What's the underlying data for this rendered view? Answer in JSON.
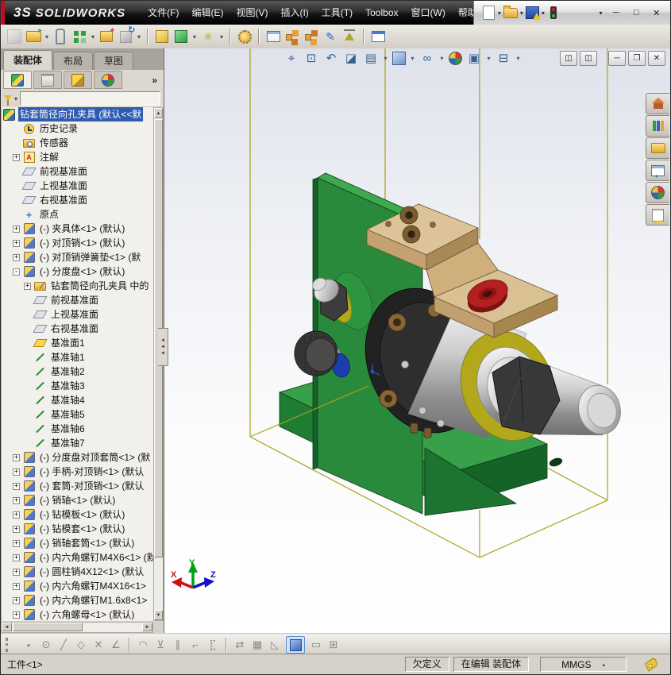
{
  "colors": {
    "brand_red": "#c20d1e",
    "selection_blue": "#2f5bb0",
    "base_green": "#2f8f3f",
    "bracket_tan": "#d9c194",
    "ring_yellow": "#b3a81c",
    "bushing_red": "#b42020",
    "collar_blue": "#1c3dae",
    "bbox_yellow": "#a9a114"
  },
  "titlebar": {
    "logo_prefix": "3S",
    "logo_text": "SOLIDWORKS",
    "menus": [
      {
        "label": "文件(F)"
      },
      {
        "label": "编辑(E)"
      },
      {
        "label": "视图(V)"
      },
      {
        "label": "插入(I)"
      },
      {
        "label": "工具(T)"
      },
      {
        "label": "Toolbox"
      },
      {
        "label": "窗口(W)"
      },
      {
        "label": "帮助(H)"
      }
    ],
    "window_buttons": {
      "minimize": "─",
      "maximize": "□",
      "close": "✕"
    }
  },
  "quick_access": {
    "buttons": [
      {
        "name": "new-document-button",
        "shape": "page",
        "dd": "▾"
      },
      {
        "name": "open-document-button",
        "shape": "folder",
        "dd": "▾"
      },
      {
        "name": "save-document-button",
        "shape": "save-warn",
        "dd": "▾"
      },
      {
        "name": "solidworks-resources-icon",
        "shape": "traffic-light",
        "dd": ""
      },
      {
        "name": "info-icon",
        "shape": "info",
        "dd": ""
      },
      {
        "name": "help-button",
        "shape": "help",
        "dd": "▾"
      }
    ]
  },
  "assembly_toolbar": {
    "items": [
      {
        "k": "i",
        "shape": "cube-gray",
        "name": "insert-component-icon",
        "glyph": ""
      },
      {
        "k": "i",
        "shape": "folder-green",
        "name": "insert-from-file-icon",
        "glyph": ""
      },
      {
        "k": "d",
        "name": "dropdown-arrow-icon",
        "glyph": "▾"
      },
      {
        "k": "i",
        "shape": "paperclip",
        "name": "mate-icon",
        "glyph": ""
      },
      {
        "k": "i",
        "shape": "blocks-green",
        "name": "linear-component-pattern-icon",
        "glyph": ""
      },
      {
        "k": "d",
        "name": "dropdown-arrow-icon",
        "glyph": "▾"
      },
      {
        "k": "i",
        "shape": "star-box",
        "name": "smart-fasteners-icon",
        "glyph": ""
      },
      {
        "k": "i",
        "shape": "cube-rotate",
        "name": "rotate-component-icon",
        "glyph": ""
      },
      {
        "k": "d",
        "name": "dropdown-arrow-icon",
        "glyph": "▾"
      },
      {
        "k": "s",
        "name": "toolbar-separator",
        "glyph": ""
      },
      {
        "k": "i",
        "shape": "cube-yellow",
        "name": "show-hidden-components-icon",
        "glyph": ""
      },
      {
        "k": "i",
        "shape": "cube-green",
        "name": "assembly-features-icon",
        "glyph": ""
      },
      {
        "k": "d",
        "name": "dropdown-arrow-icon",
        "glyph": "▾"
      },
      {
        "k": "i",
        "shape": "sparkle",
        "name": "reference-geometry-icon",
        "glyph": "✳"
      },
      {
        "k": "d",
        "name": "dropdown-arrow-icon",
        "glyph": "▾"
      },
      {
        "k": "s",
        "name": "toolbar-separator",
        "glyph": ""
      },
      {
        "k": "i",
        "shape": "gear",
        "name": "new-motion-study-icon",
        "glyph": ""
      },
      {
        "k": "s",
        "name": "toolbar-separator",
        "glyph": ""
      },
      {
        "k": "i",
        "shape": "table",
        "name": "bill-of-materials-icon",
        "glyph": ""
      },
      {
        "k": "i",
        "shape": "explode-orange",
        "name": "exploded-view-icon",
        "glyph": ""
      },
      {
        "k": "i",
        "shape": "explode-orange2",
        "name": "explode-line-sketch-icon",
        "glyph": ""
      },
      {
        "k": "i",
        "shape": "pencil-blue",
        "name": "interference-detection-icon",
        "glyph": "✎"
      },
      {
        "k": "i",
        "shape": "scale",
        "name": "assemblyxpert-icon",
        "glyph": ""
      },
      {
        "k": "s",
        "name": "toolbar-separator",
        "glyph": ""
      },
      {
        "k": "i",
        "shape": "window",
        "name": "isolate-icon",
        "glyph": ""
      }
    ]
  },
  "command_tabs": {
    "items": [
      {
        "label": "装配体",
        "cls": "active"
      },
      {
        "label": "布局",
        "cls": ""
      },
      {
        "label": "草图",
        "cls": ""
      }
    ]
  },
  "panel_tabs": {
    "items": [
      {
        "name": "tab-featuremanager",
        "shape": "fm",
        "cls": "active"
      },
      {
        "name": "tab-propertymanager",
        "shape": "pm",
        "cls": ""
      },
      {
        "name": "tab-configurationmanager",
        "shape": "cm",
        "cls": ""
      },
      {
        "name": "tab-displaymanager",
        "shape": "dm",
        "cls": ""
      }
    ],
    "overflow": "»"
  },
  "feature_tree": {
    "items": [
      {
        "cls": "root sel",
        "exp": "",
        "icon": "assembly",
        "label": "钻套筒径向孔夹具 (默认<<默"
      },
      {
        "cls": "",
        "exp": "",
        "icon": "history",
        "label": "历史记录"
      },
      {
        "cls": "",
        "exp": "",
        "icon": "sensors",
        "label": "传感器"
      },
      {
        "cls": "",
        "exp": "+",
        "icon": "annotations",
        "label": "注解"
      },
      {
        "cls": "",
        "exp": "",
        "icon": "plane",
        "label": "前视基准面"
      },
      {
        "cls": "",
        "exp": "",
        "icon": "plane",
        "label": "上视基准面"
      },
      {
        "cls": "",
        "exp": "",
        "icon": "plane",
        "label": "右视基准面"
      },
      {
        "cls": "",
        "exp": "",
        "icon": "origin",
        "label": "原点"
      },
      {
        "cls": "",
        "exp": "+",
        "icon": "part",
        "label": "(-) 夹具体<1> (默认)"
      },
      {
        "cls": "",
        "exp": "+",
        "icon": "part",
        "label": "(-) 对顶销<1> (默认)"
      },
      {
        "cls": "",
        "exp": "+",
        "icon": "part",
        "label": "(-) 对顶销弹簧垫<1> (默"
      },
      {
        "cls": "",
        "exp": "-",
        "icon": "part",
        "label": "(-) 分度盘<1> (默认)"
      },
      {
        "cls": "ind1",
        "exp": "+",
        "icon": "folder",
        "label": "钻套筒径向孔夹具 中的"
      },
      {
        "cls": "ind1",
        "exp": "",
        "icon": "plane",
        "label": "前视基准面"
      },
      {
        "cls": "ind1",
        "exp": "",
        "icon": "plane",
        "label": "上视基准面"
      },
      {
        "cls": "ind1",
        "exp": "",
        "icon": "plane",
        "label": "右视基准面"
      },
      {
        "cls": "ind1",
        "exp": "",
        "icon": "plane-sel",
        "label": "基准面1"
      },
      {
        "cls": "ind1",
        "exp": "",
        "icon": "axis",
        "label": "基准轴1"
      },
      {
        "cls": "ind1",
        "exp": "",
        "icon": "axis",
        "label": "基准轴2"
      },
      {
        "cls": "ind1",
        "exp": "",
        "icon": "axis",
        "label": "基准轴3"
      },
      {
        "cls": "ind1",
        "exp": "",
        "icon": "axis",
        "label": "基准轴4"
      },
      {
        "cls": "ind1",
        "exp": "",
        "icon": "axis",
        "label": "基准轴5"
      },
      {
        "cls": "ind1",
        "exp": "",
        "icon": "axis",
        "label": "基准轴6"
      },
      {
        "cls": "ind1",
        "exp": "",
        "icon": "axis",
        "label": "基准轴7"
      },
      {
        "cls": "",
        "exp": "+",
        "icon": "part",
        "label": "(-) 分度盘对顶套筒<1> (默"
      },
      {
        "cls": "",
        "exp": "+",
        "icon": "part",
        "label": "(-) 手柄-对顶销<1> (默认"
      },
      {
        "cls": "",
        "exp": "+",
        "icon": "part",
        "label": "(-) 套筒-对顶销<1> (默认"
      },
      {
        "cls": "",
        "exp": "+",
        "icon": "part",
        "label": "(-) 销轴<1> (默认)"
      },
      {
        "cls": "",
        "exp": "+",
        "icon": "part",
        "label": "(-) 钻模板<1> (默认)"
      },
      {
        "cls": "",
        "exp": "+",
        "icon": "part",
        "label": "(-) 钻模套<1> (默认)"
      },
      {
        "cls": "",
        "exp": "+",
        "icon": "part",
        "label": "(-) 销轴套筒<1> (默认)"
      },
      {
        "cls": "",
        "exp": "+",
        "icon": "part",
        "label": "(-) 内六角螺钉M4X6<1> (默"
      },
      {
        "cls": "",
        "exp": "+",
        "icon": "part",
        "label": "(-) 圆柱销4X12<1> (默认"
      },
      {
        "cls": "",
        "exp": "+",
        "icon": "part",
        "label": "(-) 内六角螺钉M4X16<1>"
      },
      {
        "cls": "",
        "exp": "+",
        "icon": "part",
        "label": "(-) 内六角螺钉M1.6x8<1>"
      },
      {
        "cls": "",
        "exp": "+",
        "icon": "part",
        "label": "(-) 六角螺母<1> (默认)"
      }
    ]
  },
  "headsup": {
    "items": [
      {
        "k": "i",
        "glyph": "⌖",
        "name": "zoom-fit-icon"
      },
      {
        "k": "i",
        "glyph": "⊡",
        "name": "zoom-area-icon"
      },
      {
        "k": "i",
        "glyph": "↶",
        "name": "previous-view-icon"
      },
      {
        "k": "i",
        "glyph": "◪",
        "name": "section-view-icon"
      },
      {
        "k": "i",
        "glyph": "▤",
        "name": "view-selector-icon"
      },
      {
        "k": "d",
        "glyph": "▾",
        "name": "dropdown-arrow-icon"
      },
      {
        "k": "cube",
        "glyph": "",
        "name": "view-orientation-icon"
      },
      {
        "k": "d",
        "glyph": "▾",
        "name": "dropdown-arrow-icon"
      },
      {
        "k": "i",
        "glyph": "∞",
        "name": "hide-show-items-icon"
      },
      {
        "k": "d",
        "glyph": "▾",
        "name": "dropdown-arrow-icon"
      },
      {
        "k": "ball",
        "glyph": "",
        "name": "edit-appearance-icon"
      },
      {
        "k": "i",
        "glyph": "▣",
        "name": "apply-scene-icon"
      },
      {
        "k": "d",
        "glyph": "▾",
        "name": "dropdown-arrow-icon"
      },
      {
        "k": "i",
        "glyph": "⊟",
        "name": "view-settings-icon"
      },
      {
        "k": "d",
        "glyph": "▾",
        "name": "dropdown-arrow-icon"
      }
    ]
  },
  "child_window": {
    "buttons": [
      {
        "name": "pane-toggle-left-button",
        "glyph": "◫"
      },
      {
        "name": "pane-toggle-right-button",
        "glyph": "◫"
      },
      {
        "name": "child-minimize-button",
        "glyph": "─"
      },
      {
        "name": "child-restore-button",
        "glyph": "❐"
      },
      {
        "name": "child-close-button",
        "glyph": "✕"
      }
    ]
  },
  "task_pane": {
    "buttons": [
      {
        "name": "home-tab",
        "shape": "house"
      },
      {
        "name": "design-library-tab",
        "shape": "books"
      },
      {
        "name": "file-explorer-tab",
        "shape": "folder2"
      },
      {
        "name": "view-palette-tab",
        "shape": "palette"
      },
      {
        "name": "appearances-tab",
        "shape": "ball"
      },
      {
        "name": "custom-properties-tab",
        "shape": "form"
      }
    ]
  },
  "sketch_toolbar": {
    "items": [
      {
        "k": "h",
        "glyph": "",
        "name": "toolbar-drag-handle"
      },
      {
        "k": "i",
        "glyph": "•",
        "name": "sketch-point-icon"
      },
      {
        "k": "i",
        "glyph": "⊙",
        "name": "sketch-circle-icon"
      },
      {
        "k": "i",
        "glyph": "╱",
        "name": "sketch-line-icon"
      },
      {
        "k": "i",
        "glyph": "◇",
        "name": "sketch-polygon-icon"
      },
      {
        "k": "i",
        "glyph": "✕",
        "name": "sketch-trim-icon"
      },
      {
        "k": "i",
        "glyph": "∠",
        "name": "sketch-angle-icon"
      },
      {
        "k": "s",
        "glyph": "",
        "name": "toolbar-separator"
      },
      {
        "k": "i",
        "glyph": "◠",
        "name": "sketch-arc-icon"
      },
      {
        "k": "i",
        "glyph": "⊻",
        "name": "sketch-perpendicular-icon"
      },
      {
        "k": "i",
        "glyph": "∥",
        "name": "sketch-parallel-icon"
      },
      {
        "k": "i",
        "glyph": "⌐",
        "name": "sketch-corner-icon"
      },
      {
        "k": "i",
        "glyph": "⣏",
        "name": "sketch-spline-icon"
      },
      {
        "k": "s",
        "glyph": "",
        "name": "toolbar-separator"
      },
      {
        "k": "i",
        "glyph": "⇄",
        "name": "mirror-entities-icon"
      },
      {
        "k": "i",
        "glyph": "▦",
        "name": "grid-snap-icon"
      },
      {
        "k": "i",
        "glyph": "◺",
        "name": "measure-angle-icon"
      },
      {
        "k": "c",
        "glyph": "",
        "name": "shaded-view-button"
      },
      {
        "k": "i",
        "glyph": "▭",
        "name": "single-view-icon"
      },
      {
        "k": "i",
        "glyph": "⊞",
        "name": "four-view-icon"
      }
    ]
  },
  "statusbar": {
    "left": "工件<1>",
    "definition": "欠定义",
    "editing": "在编辑 装配体",
    "units": "MMGS",
    "units_arrow": "▴"
  },
  "triad": {
    "x": "X",
    "y": "Y",
    "z": "Z"
  }
}
